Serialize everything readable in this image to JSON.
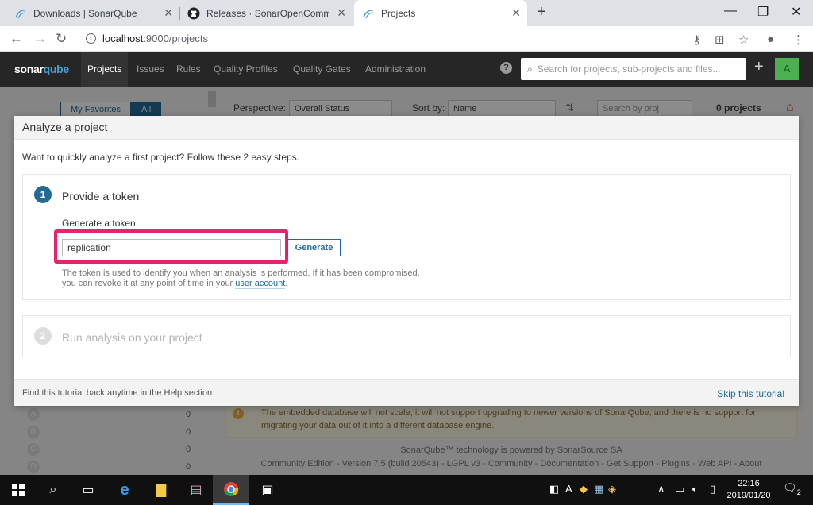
{
  "browser": {
    "tabs": [
      {
        "title": "Downloads | SonarQube",
        "icon": "sonarqube-icon"
      },
      {
        "title": "Releases · SonarOpenCommunity",
        "icon": "github-icon"
      },
      {
        "title": "Projects",
        "icon": "sonarqube-icon"
      }
    ],
    "url_host": "localhost",
    "url_path": ":9000/projects"
  },
  "sonar": {
    "brand_left": "sonar",
    "brand_right": "qube",
    "nav": [
      "Projects",
      "Issues",
      "Rules",
      "Quality Profiles",
      "Quality Gates",
      "Administration"
    ],
    "search_placeholder": "Search for projects, sub-projects and files...",
    "avatar": "A",
    "filters": {
      "my_favorites": "My Favorites",
      "all": "All"
    },
    "perspective_label": "Perspective:",
    "perspective_value": "Overall Status",
    "sort_label": "Sort by:",
    "sort_value": "Name",
    "project_search_placeholder": "Search by proj",
    "project_count": "0 projects",
    "ratings": [
      {
        "grade": "A",
        "count": "0"
      },
      {
        "grade": "B",
        "count": "0"
      },
      {
        "grade": "C",
        "count": "0"
      },
      {
        "grade": "D",
        "count": "0"
      }
    ],
    "warning_line1": "The embedded database will not scale, it will not support upgrading to newer versions of SonarQube, and there is no support for",
    "warning_line2": "migrating your data out of it into a different database engine.",
    "footer_line1": "SonarQube™ technology is powered by SonarSource SA",
    "footer_line2": "Community Edition - Version 7.5 (build 20543) - LGPL v3 - Community - Documentation - Get Support - Plugins - Web API - About"
  },
  "modal": {
    "title": "Analyze a project",
    "intro": "Want to quickly analyze a first project? Follow these 2 easy steps.",
    "step1": {
      "number": "1",
      "title": "Provide a token",
      "label": "Generate a token",
      "input_value": "replication",
      "button": "Generate",
      "help_line1": "The token is used to identify you when an analysis is performed. If it has been compromised,",
      "help_line2_prefix": "you can revoke it at any point of time in your ",
      "help_link": "user account",
      "help_line2_suffix": "."
    },
    "step2": {
      "number": "2",
      "title": "Run analysis on your project"
    },
    "footer_left": "Find this tutorial back anytime in the Help section",
    "footer_right": "Skip this tutorial"
  },
  "taskbar": {
    "time": "22:16",
    "date": "2019/01/20",
    "notifications": "2",
    "ime": "A"
  },
  "colors": {
    "accent": "#236a97",
    "highlight": "#e8236d",
    "nav_bg": "#262626"
  }
}
